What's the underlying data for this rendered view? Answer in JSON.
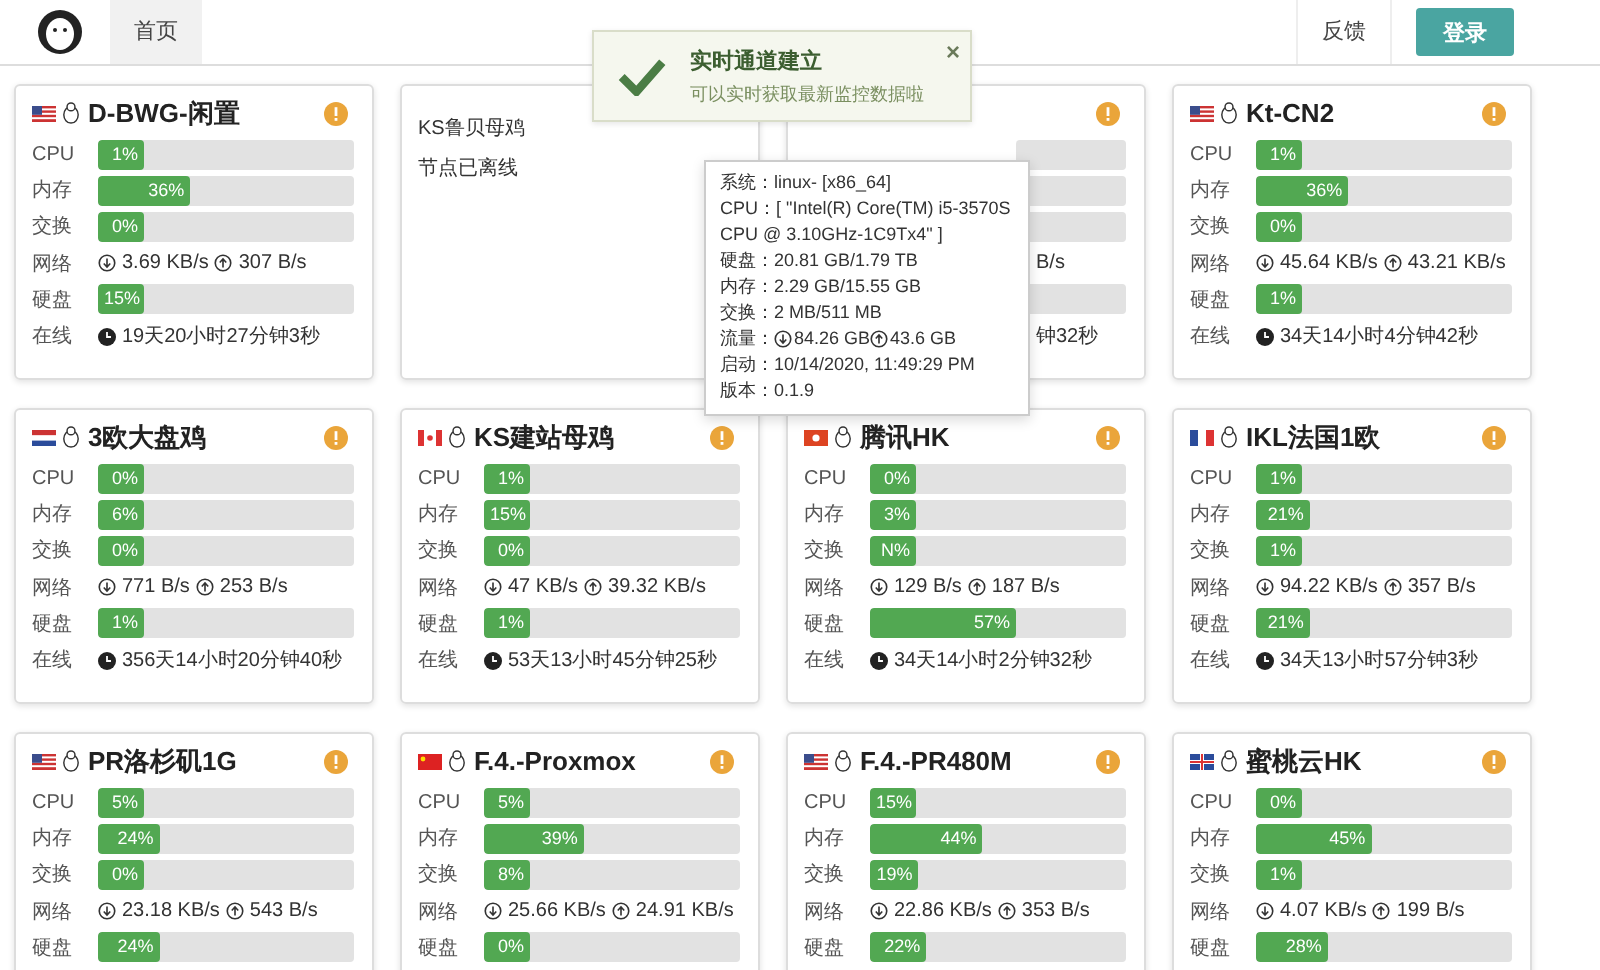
{
  "nav": {
    "tabs": [
      {
        "label": "首页",
        "selected": true
      }
    ],
    "feedback": "反馈",
    "login": "登录"
  },
  "toast": {
    "title": "实时通道建立",
    "message": "可以实时获取最新监控数据啦",
    "close": "×"
  },
  "tooltip": {
    "items": [
      {
        "kind": "text",
        "label": "系统：",
        "value": "linux- [x86_64]"
      },
      {
        "kind": "text",
        "label": "CPU：",
        "value": "[ \"Intel(R) Core(TM) i5-3570S CPU @ 3.10GHz-1C9Tx4\" ]"
      },
      {
        "kind": "text",
        "label": "硬盘：",
        "value": "20.81 GB/1.79 TB"
      },
      {
        "kind": "text",
        "label": "内存：",
        "value": "2.29 GB/15.55 GB"
      },
      {
        "kind": "text",
        "label": "交换：",
        "value": "2 MB/511 MB"
      },
      {
        "kind": "traffic",
        "label": "流量：",
        "down": "84.26 GB",
        "up": "43.6 GB"
      },
      {
        "kind": "text",
        "label": "启动：",
        "value": "10/14/2020, 11:49:29 PM"
      },
      {
        "kind": "text",
        "label": "版本：",
        "value": "0.1.9"
      }
    ]
  },
  "servers": [
    {
      "kind": "online",
      "flag": {
        "kind": "us"
      },
      "name": "D-BWG-闲置",
      "rows": [
        {
          "kind": "bar",
          "label": "CPU",
          "level": 0.01,
          "reading": "1%"
        },
        {
          "kind": "bar",
          "label": "内存",
          "level": 0.36,
          "reading": "36%"
        },
        {
          "kind": "bar",
          "label": "交换",
          "level": 0,
          "reading": "0%"
        },
        {
          "kind": "net",
          "label": "网络",
          "down": "3.69 KB/s",
          "up": "307 B/s"
        },
        {
          "kind": "bar",
          "label": "硬盘",
          "level": 0.15,
          "reading": "15%"
        },
        {
          "kind": "uptime",
          "label": "在线",
          "value": "19天20小时27分钟3秒"
        }
      ]
    },
    {
      "kind": "offline",
      "name": "KS鲁贝母鸡",
      "status": "节点已离线"
    },
    {
      "kind": "covered",
      "rows": [
        {
          "kind": "track"
        },
        {
          "kind": "track"
        },
        {
          "kind": "track"
        },
        {
          "kind": "fragment",
          "value": "B/s"
        },
        {
          "kind": "track"
        },
        {
          "kind": "fragment",
          "value": "钟32秒"
        }
      ]
    },
    {
      "kind": "online",
      "flag": {
        "kind": "us"
      },
      "name": "Kt-CN2",
      "rows": [
        {
          "kind": "bar",
          "label": "CPU",
          "level": 0.01,
          "reading": "1%"
        },
        {
          "kind": "bar",
          "label": "内存",
          "level": 0.36,
          "reading": "36%"
        },
        {
          "kind": "bar",
          "label": "交换",
          "level": 0,
          "reading": "0%"
        },
        {
          "kind": "net",
          "label": "网络",
          "down": "45.64 KB/s",
          "up": "43.21 KB/s"
        },
        {
          "kind": "bar",
          "label": "硬盘",
          "level": 0.01,
          "reading": "1%"
        },
        {
          "kind": "uptime",
          "label": "在线",
          "value": "34天14小时4分钟42秒"
        }
      ]
    },
    {
      "kind": "online",
      "flag": {
        "kind": "nl"
      },
      "name": "3欧大盘鸡",
      "rows": [
        {
          "kind": "bar",
          "label": "CPU",
          "level": 0,
          "reading": "0%"
        },
        {
          "kind": "bar",
          "label": "内存",
          "level": 0.06,
          "reading": "6%"
        },
        {
          "kind": "bar",
          "label": "交换",
          "level": 0,
          "reading": "0%"
        },
        {
          "kind": "net",
          "label": "网络",
          "down": "771 B/s",
          "up": "253 B/s"
        },
        {
          "kind": "bar",
          "label": "硬盘",
          "level": 0.01,
          "reading": "1%"
        },
        {
          "kind": "uptime",
          "label": "在线",
          "value": "356天14小时20分钟40秒"
        }
      ]
    },
    {
      "kind": "online",
      "flag": {
        "kind": "ca"
      },
      "name": "KS建站母鸡",
      "rows": [
        {
          "kind": "bar",
          "label": "CPU",
          "level": 0.01,
          "reading": "1%"
        },
        {
          "kind": "bar",
          "label": "内存",
          "level": 0.15,
          "reading": "15%"
        },
        {
          "kind": "bar",
          "label": "交换",
          "level": 0,
          "reading": "0%"
        },
        {
          "kind": "net",
          "label": "网络",
          "down": "47 KB/s",
          "up": "39.32 KB/s"
        },
        {
          "kind": "bar",
          "label": "硬盘",
          "level": 0.01,
          "reading": "1%"
        },
        {
          "kind": "uptime",
          "label": "在线",
          "value": "53天13小时45分钟25秒"
        }
      ]
    },
    {
      "kind": "online",
      "flag": {
        "kind": "hk"
      },
      "name": "腾讯HK",
      "rows": [
        {
          "kind": "bar",
          "label": "CPU",
          "level": 0,
          "reading": "0%"
        },
        {
          "kind": "bar",
          "label": "内存",
          "level": 0.03,
          "reading": "3%"
        },
        {
          "kind": "bar",
          "label": "交换",
          "level": 0,
          "reading": "N%"
        },
        {
          "kind": "net",
          "label": "网络",
          "down": "129 B/s",
          "up": "187 B/s"
        },
        {
          "kind": "bar",
          "label": "硬盘",
          "level": 0.57,
          "reading": "57%"
        },
        {
          "kind": "uptime",
          "label": "在线",
          "value": "34天14小时2分钟32秒"
        }
      ]
    },
    {
      "kind": "online",
      "flag": {
        "kind": "fr"
      },
      "name": "IKL法国1欧",
      "rows": [
        {
          "kind": "bar",
          "label": "CPU",
          "level": 0.01,
          "reading": "1%"
        },
        {
          "kind": "bar",
          "label": "内存",
          "level": 0.21,
          "reading": "21%"
        },
        {
          "kind": "bar",
          "label": "交换",
          "level": 0.01,
          "reading": "1%"
        },
        {
          "kind": "net",
          "label": "网络",
          "down": "94.22 KB/s",
          "up": "357 B/s"
        },
        {
          "kind": "bar",
          "label": "硬盘",
          "level": 0.21,
          "reading": "21%"
        },
        {
          "kind": "uptime",
          "label": "在线",
          "value": "34天13小时57分钟3秒"
        }
      ]
    },
    {
      "kind": "online",
      "flag": {
        "kind": "us"
      },
      "name": "PR洛杉矶1G",
      "rows": [
        {
          "kind": "bar",
          "label": "CPU",
          "level": 0.05,
          "reading": "5%"
        },
        {
          "kind": "bar",
          "label": "内存",
          "level": 0.24,
          "reading": "24%"
        },
        {
          "kind": "bar",
          "label": "交换",
          "level": 0,
          "reading": "0%"
        },
        {
          "kind": "net",
          "label": "网络",
          "down": "23.18 KB/s",
          "up": "543 B/s"
        },
        {
          "kind": "bar",
          "label": "硬盘",
          "level": 0.24,
          "reading": "24%"
        }
      ]
    },
    {
      "kind": "online",
      "flag": {
        "kind": "cn"
      },
      "name": "F.4.-Proxmox",
      "rows": [
        {
          "kind": "bar",
          "label": "CPU",
          "level": 0.05,
          "reading": "5%"
        },
        {
          "kind": "bar",
          "label": "内存",
          "level": 0.39,
          "reading": "39%"
        },
        {
          "kind": "bar",
          "label": "交换",
          "level": 0.08,
          "reading": "8%"
        },
        {
          "kind": "net",
          "label": "网络",
          "down": "25.66 KB/s",
          "up": "24.91 KB/s"
        },
        {
          "kind": "bar",
          "label": "硬盘",
          "level": 0.1,
          "reading": "0%"
        }
      ]
    },
    {
      "kind": "online",
      "flag": {
        "kind": "us"
      },
      "name": "F.4.-PR480M",
      "rows": [
        {
          "kind": "bar",
          "label": "CPU",
          "level": 0.15,
          "reading": "15%"
        },
        {
          "kind": "bar",
          "label": "内存",
          "level": 0.44,
          "reading": "44%"
        },
        {
          "kind": "bar",
          "label": "交换",
          "level": 0.19,
          "reading": "19%"
        },
        {
          "kind": "net",
          "label": "网络",
          "down": "22.86 KB/s",
          "up": "353 B/s"
        },
        {
          "kind": "bar",
          "label": "硬盘",
          "level": 0.22,
          "reading": "22%"
        }
      ]
    },
    {
      "kind": "online",
      "flag": {
        "kind": "gb"
      },
      "name": "蜜桃云HK",
      "rows": [
        {
          "kind": "bar",
          "label": "CPU",
          "level": 0,
          "reading": "0%"
        },
        {
          "kind": "bar",
          "label": "内存",
          "level": 0.45,
          "reading": "45%"
        },
        {
          "kind": "bar",
          "label": "交换",
          "level": 0.01,
          "reading": "1%"
        },
        {
          "kind": "net",
          "label": "网络",
          "down": "4.07 KB/s",
          "up": "199 B/s"
        },
        {
          "kind": "bar",
          "label": "硬盘",
          "level": 0.28,
          "reading": "28%"
        }
      ]
    }
  ]
}
